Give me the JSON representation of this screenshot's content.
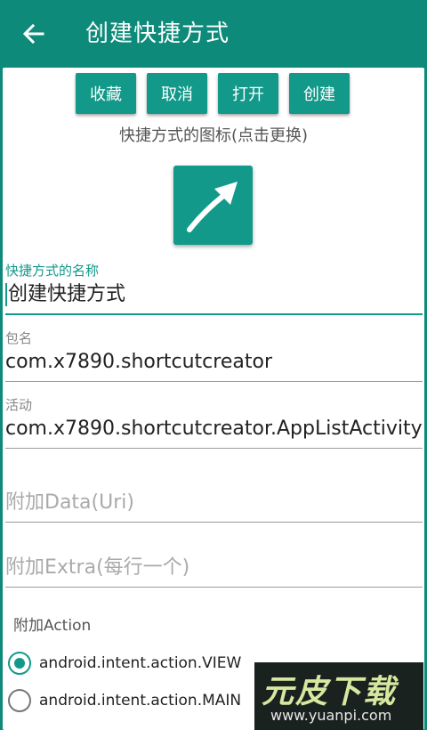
{
  "appbar": {
    "title": "创建快捷方式",
    "back_icon": "arrow-left-icon"
  },
  "buttons": [
    "收藏",
    "取消",
    "打开",
    "创建"
  ],
  "icon_section": {
    "caption": "快捷方式的图标(点击更换)",
    "icon": "diagonal-arrow-icon"
  },
  "fields": {
    "name": {
      "label": "快捷方式的名称",
      "value": "创建快捷方式"
    },
    "package": {
      "label": "包名",
      "value": "com.x7890.shortcutcreator"
    },
    "activity": {
      "label": "活动",
      "value": "com.x7890.shortcutcreator.AppListActivity"
    },
    "data_uri": {
      "placeholder": "附加Data(Uri)"
    },
    "extra": {
      "placeholder": "附加Extra(每行一个)"
    }
  },
  "action_section": {
    "label": "附加Action",
    "options": [
      {
        "label": "android.intent.action.VIEW",
        "checked": true
      },
      {
        "label": "android.intent.action.MAIN",
        "checked": false
      }
    ]
  },
  "watermark": {
    "title": "元皮下载",
    "url": "www.yuanpi.com"
  },
  "colors": {
    "accent": "#12998a",
    "appbar": "#0e8a7a"
  }
}
